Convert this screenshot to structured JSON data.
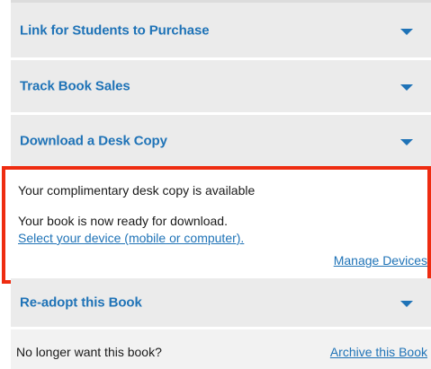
{
  "accordion": {
    "items": [
      {
        "label": "Link for Students to Purchase"
      },
      {
        "label": "Track Book Sales"
      },
      {
        "label": "Download a Desk Copy"
      },
      {
        "label": "Re-adopt this Book"
      }
    ]
  },
  "desk_copy": {
    "status": "Your complimentary desk copy is available",
    "ready": "Your book is now ready for download.",
    "select_device_link": "Select your device (mobile or computer).",
    "manage_devices_link": "Manage Devices"
  },
  "footer": {
    "question": "No longer want this book?",
    "archive_link": "Archive this Book"
  },
  "colors": {
    "link": "#1f73b7",
    "panel_bg": "#ebebeb",
    "highlight_border": "#ee2c11"
  }
}
